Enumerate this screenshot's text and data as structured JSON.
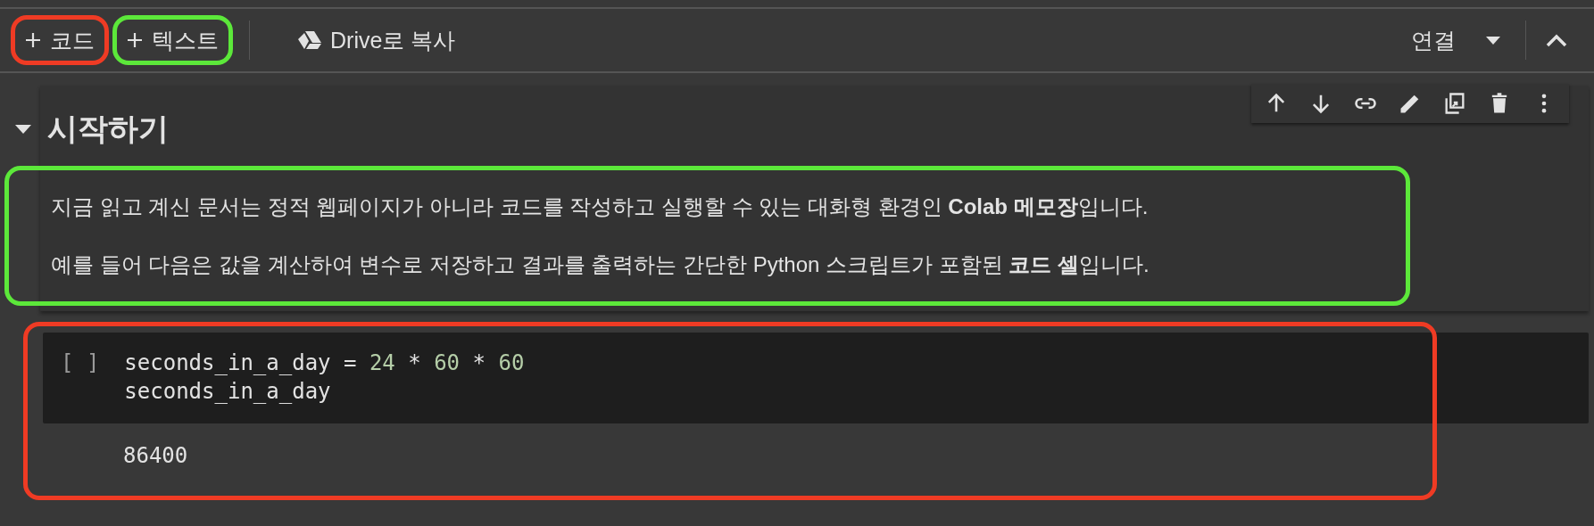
{
  "toolbar": {
    "buttons": [
      {
        "kind": "add",
        "label": "코드",
        "color": "#ef3b24"
      },
      {
        "kind": "add",
        "label": "텍스트",
        "color": "#5ce83a"
      },
      {
        "kind": "drive",
        "label": "Drive로 복사"
      }
    ],
    "connect": {
      "label": "연결"
    }
  },
  "text_cell": {
    "expanded": true,
    "heading": "시작하기",
    "color": "#5ce83a",
    "actions": [
      {
        "kind": "up"
      },
      {
        "kind": "down"
      },
      {
        "kind": "link"
      },
      {
        "kind": "edit"
      },
      {
        "kind": "mirror"
      },
      {
        "kind": "delete"
      },
      {
        "kind": "more"
      }
    ],
    "paragraphs": [
      "지금 읽고 계신 문서는 정적 웹페이지가 아니라 코드를 작성하고 실행할 수 있는 대화형 환경인 **Colab 메모장**입니다.",
      "예를 들어 다음은 값을 계산하여 변수로 저장하고 결과를 출력하는 간단한 Python 스크립트가 포함된 **코드 셀**입니다."
    ]
  },
  "code_cell": {
    "prompt": "[ ]",
    "color": "#ef3b24",
    "lines": [
      [
        {
          "kind": "plain",
          "text": "seconds_in_a_day = "
        },
        {
          "kind": "number",
          "text": "24"
        },
        {
          "kind": "plain",
          "text": " * "
        },
        {
          "kind": "number",
          "text": "60"
        },
        {
          "kind": "plain",
          "text": " * "
        },
        {
          "kind": "number",
          "text": "60"
        }
      ],
      [
        {
          "kind": "plain",
          "text": "seconds_in_a_day"
        }
      ]
    ],
    "output": "86400"
  }
}
